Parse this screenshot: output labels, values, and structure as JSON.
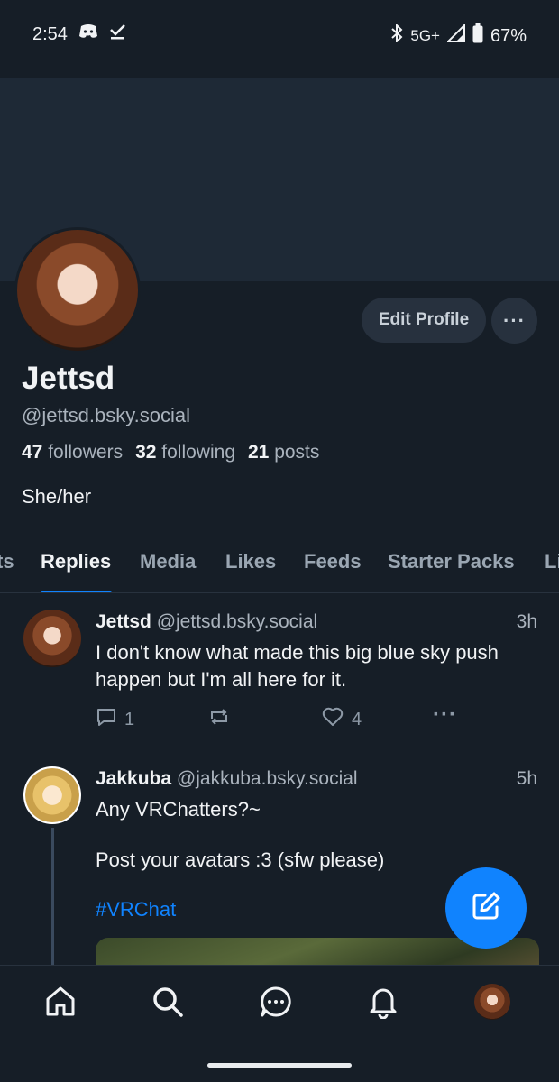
{
  "status_bar": {
    "time": "2:54",
    "network": "5G+",
    "battery": "67%"
  },
  "profile": {
    "display_name": "Jettsd",
    "handle": "@jettsd.bsky.social",
    "followers_count": "47",
    "followers_label": "followers",
    "following_count": "32",
    "following_label": "following",
    "posts_count": "21",
    "posts_label": "posts",
    "bio": "She/her",
    "edit_button": "Edit Profile",
    "more_button": "···"
  },
  "tabs": [
    {
      "label": "ts"
    },
    {
      "label": "Replies"
    },
    {
      "label": "Media"
    },
    {
      "label": "Likes"
    },
    {
      "label": "Feeds"
    },
    {
      "label": "Starter Packs"
    },
    {
      "label": "Li"
    }
  ],
  "active_tab": "Replies",
  "posts": [
    {
      "author": "Jettsd",
      "handle": "@jettsd.bsky.social",
      "time": "3h",
      "text": "I don't know what made this big blue sky push happen but I'm all here for it.",
      "reply_count": "1",
      "like_count": "4"
    },
    {
      "author": "Jakkuba",
      "handle": "@jakkuba.bsky.social",
      "time": "5h",
      "text_line1": "Any VRChatters?~",
      "text_line2": "Post your avatars :3 (sfw please)",
      "hashtag": "#VRChat"
    }
  ],
  "colors": {
    "background": "#161e27",
    "banner": "#1e2936",
    "accent": "#1083fe",
    "muted_text": "#aab3bd"
  },
  "icons": {
    "status": [
      "discord-icon",
      "check-icon",
      "bluetooth-icon",
      "signal-icon",
      "battery-icon"
    ],
    "nav": [
      "home-icon",
      "search-icon",
      "chat-icon",
      "bell-icon",
      "profile-avatar"
    ],
    "fab": "compose-icon"
  }
}
